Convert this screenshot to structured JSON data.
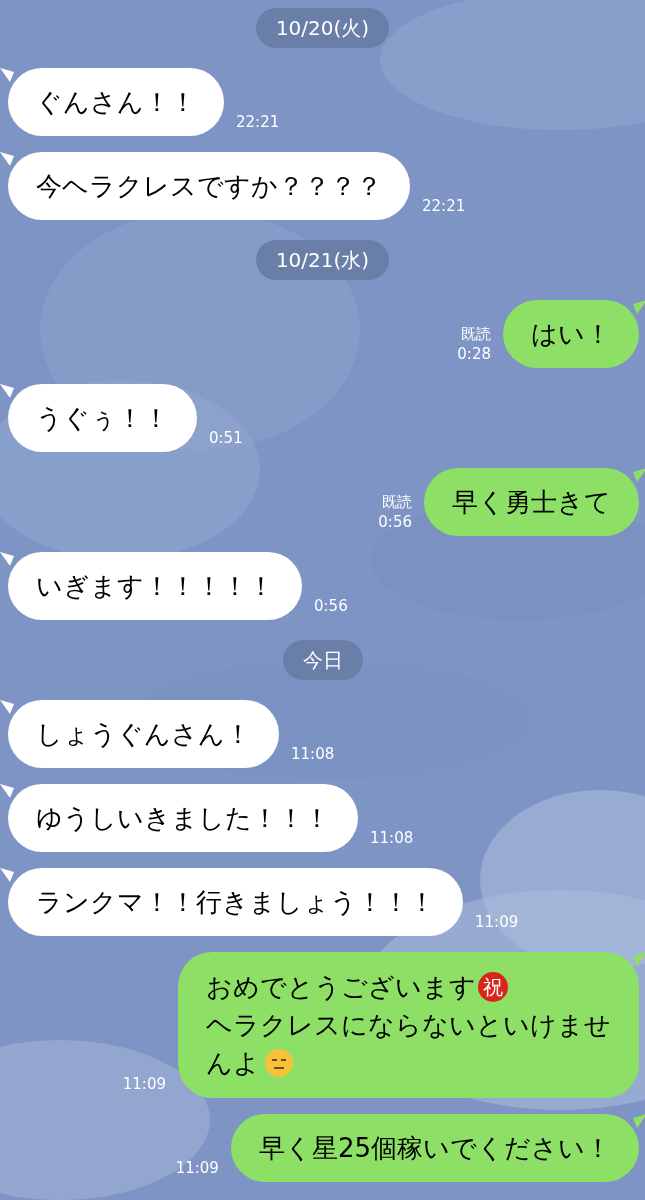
{
  "items": [
    {
      "kind": "date",
      "text": "10/20(火)"
    },
    {
      "kind": "message",
      "outgoing": false,
      "text": "ぐんさん！！",
      "time": "22:21"
    },
    {
      "kind": "message",
      "outgoing": false,
      "text": "今ヘラクレスですか？？？？",
      "time": "22:21"
    },
    {
      "kind": "date",
      "text": "10/21(水)"
    },
    {
      "kind": "message",
      "outgoing": true,
      "text": "はい！",
      "time": "0:28",
      "read": "既読"
    },
    {
      "kind": "message",
      "outgoing": false,
      "text": "うぐぅ！！",
      "time": "0:51"
    },
    {
      "kind": "message",
      "outgoing": true,
      "text": "早く勇士きて",
      "time": "0:56",
      "read": "既読"
    },
    {
      "kind": "message",
      "outgoing": false,
      "text": "いぎます！！！！！",
      "time": "0:56"
    },
    {
      "kind": "date",
      "text": "今日"
    },
    {
      "kind": "message",
      "outgoing": false,
      "text": "しょうぐんさん！",
      "time": "11:08"
    },
    {
      "kind": "message",
      "outgoing": false,
      "text": "ゆうしいきました！！！",
      "time": "11:08"
    },
    {
      "kind": "message",
      "outgoing": false,
      "text": "ランクマ！！行きましょう！！！",
      "time": "11:09"
    },
    {
      "kind": "message",
      "outgoing": true,
      "time": "11:09",
      "lines": [
        [
          {
            "kind": "text",
            "text": "おめでとうございます"
          },
          {
            "kind": "badge",
            "text": "祝"
          }
        ],
        [
          {
            "kind": "text",
            "text": "ヘラクレスにならないといけませ"
          }
        ],
        [
          {
            "kind": "text",
            "text": "んよ"
          },
          {
            "kind": "face"
          }
        ]
      ]
    },
    {
      "kind": "message",
      "outgoing": true,
      "text": "早く星25個稼いでください！",
      "time": "11:09"
    }
  ]
}
